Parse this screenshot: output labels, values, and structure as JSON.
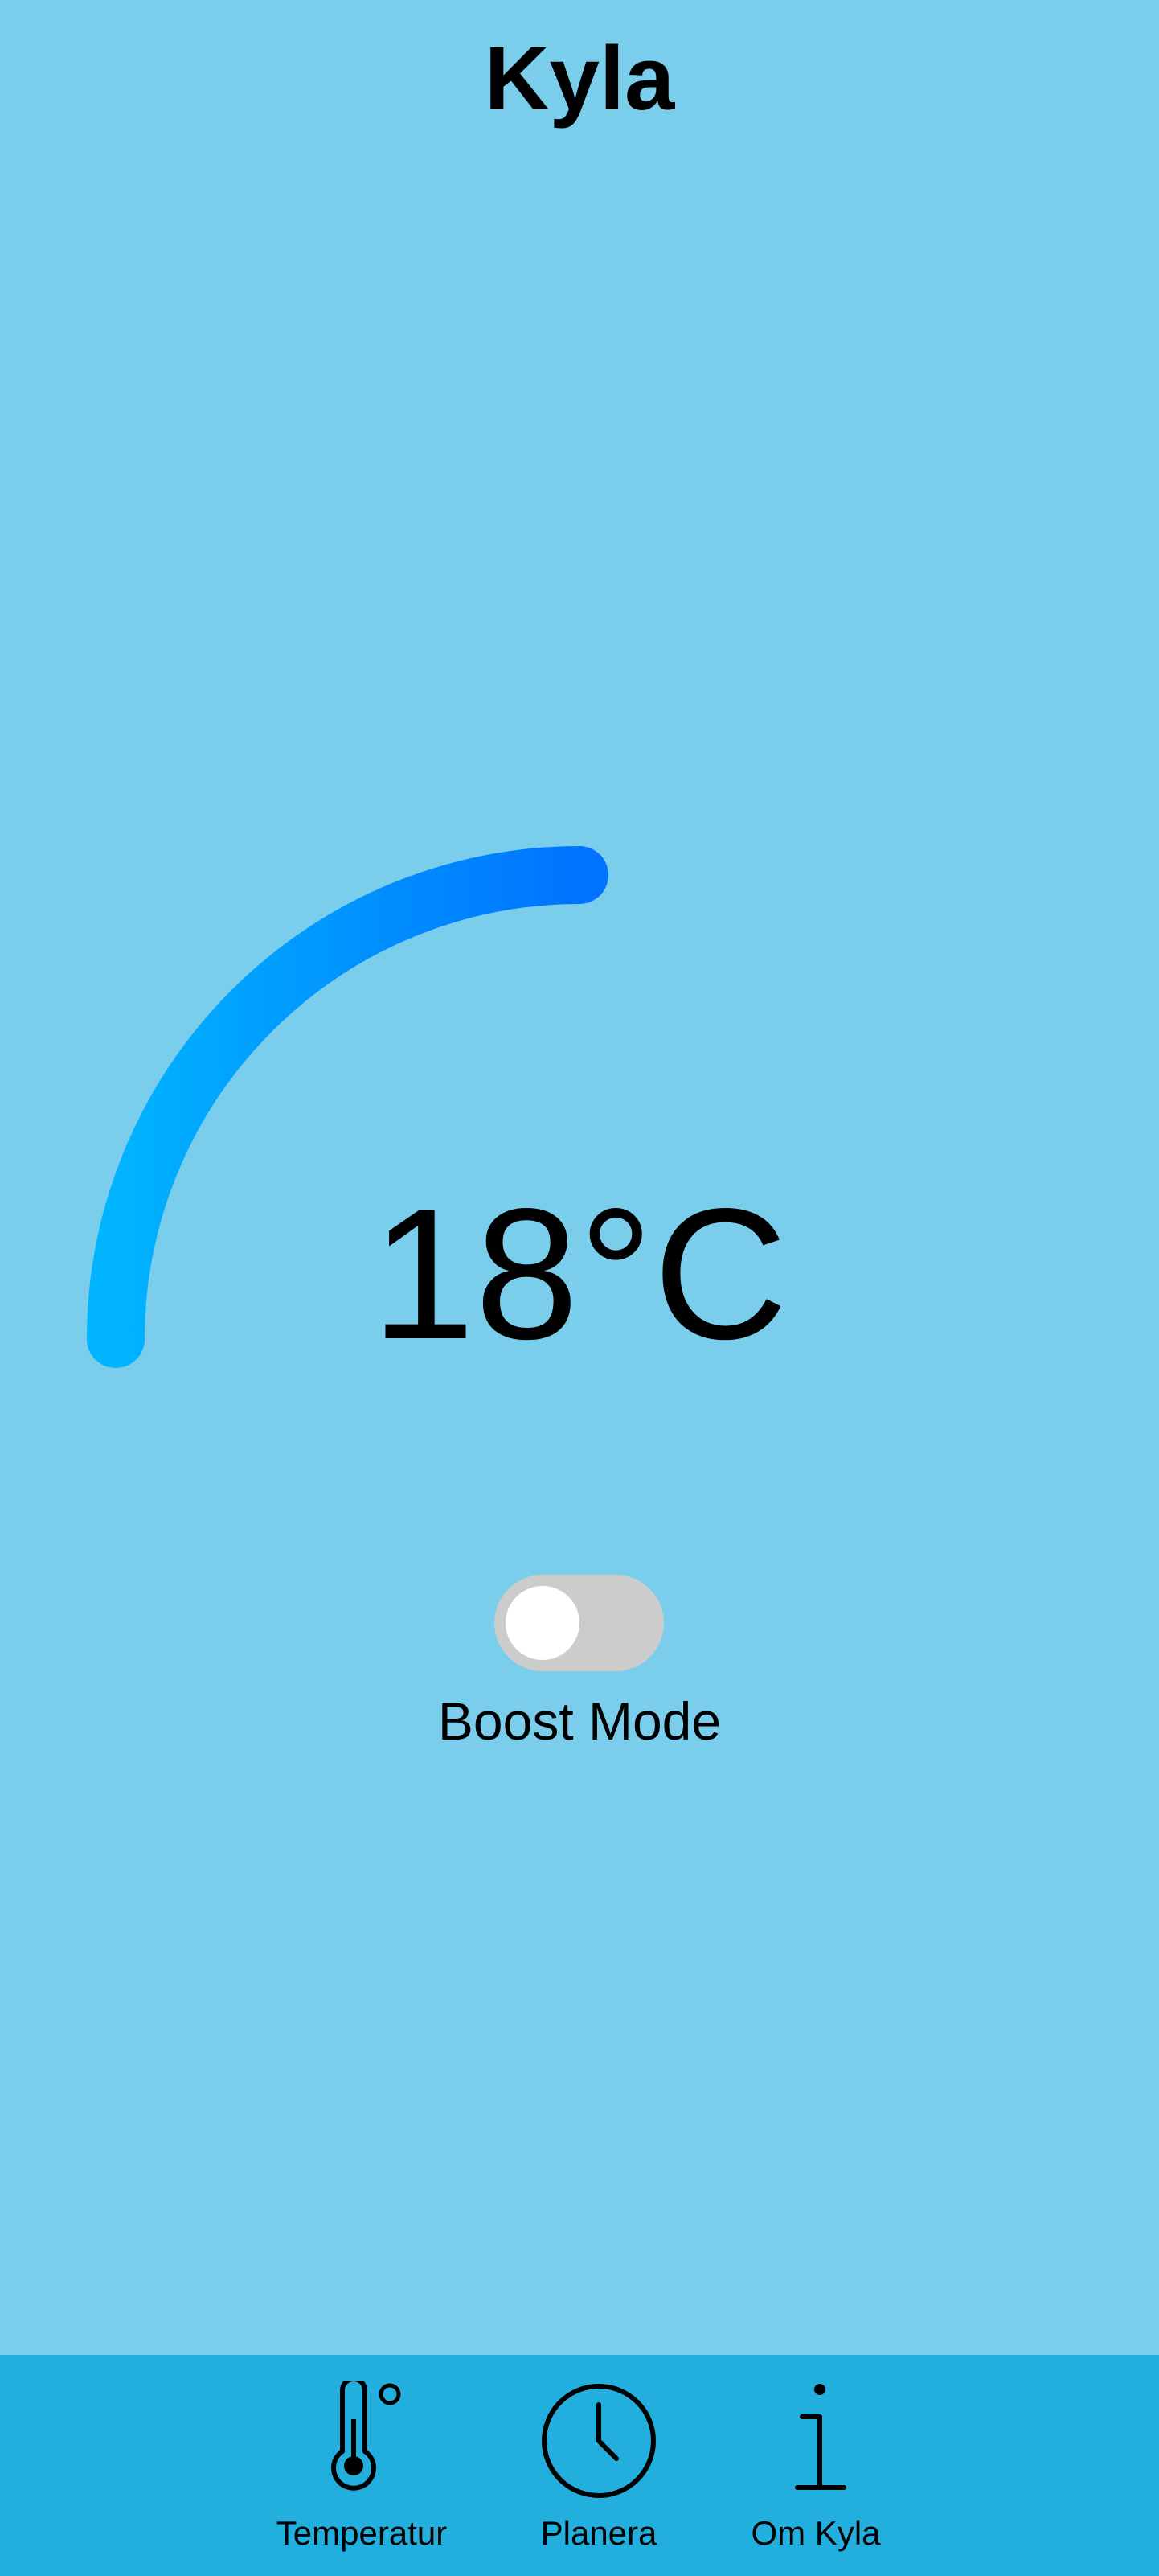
{
  "app": {
    "title": "Kyla"
  },
  "thermostat": {
    "temperature": "18°C",
    "temperature_value": 18,
    "gauge_fill_fraction": 0.25,
    "gauge_colors": [
      "#00b4ff",
      "#0073ff"
    ]
  },
  "boost": {
    "label": "Boost Mode",
    "enabled": false
  },
  "nav": {
    "items": [
      {
        "label": "Temperatur",
        "icon": "thermometer-icon"
      },
      {
        "label": "Planera",
        "icon": "clock-icon"
      },
      {
        "label": "Om Kyla",
        "icon": "info-icon"
      }
    ]
  },
  "colors": {
    "background": "#7acdeb",
    "nav_background": "#22afde",
    "toggle_off": "#cccccc"
  }
}
